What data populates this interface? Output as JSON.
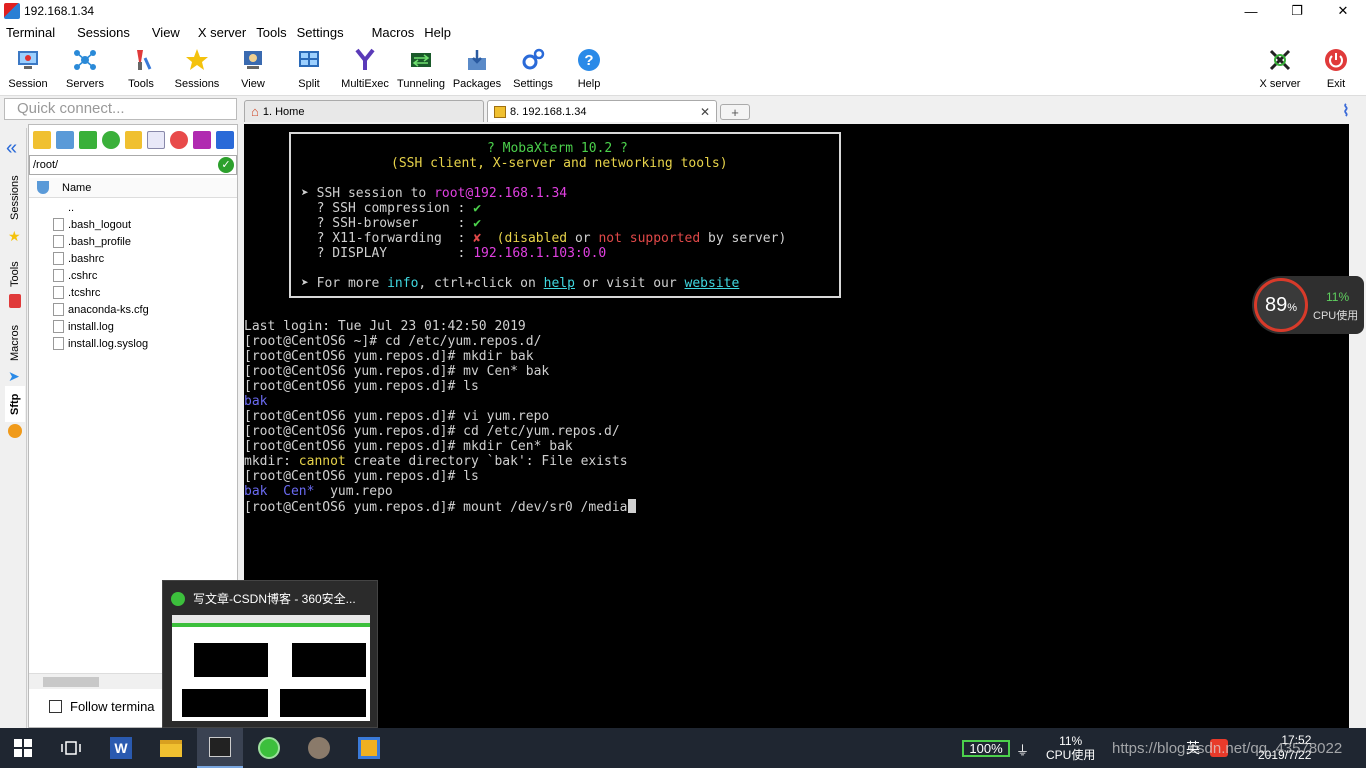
{
  "window": {
    "title": "192.168.1.34",
    "controls": [
      "—",
      "❐",
      "✕"
    ]
  },
  "menubar": [
    "Terminal",
    "Sessions",
    "View",
    "X server",
    "Tools",
    "Settings",
    "Macros",
    "Help"
  ],
  "toolbar": {
    "items": [
      {
        "label": "Session",
        "icon": "session-icon"
      },
      {
        "label": "Servers",
        "icon": "servers-icon"
      },
      {
        "label": "Tools",
        "icon": "tools-icon"
      },
      {
        "label": "Sessions",
        "icon": "star-icon"
      },
      {
        "label": "View",
        "icon": "view-icon"
      },
      {
        "label": "Split",
        "icon": "split-icon"
      },
      {
        "label": "MultiExec",
        "icon": "multiexec-icon"
      },
      {
        "label": "Tunneling",
        "icon": "tunneling-icon"
      },
      {
        "label": "Packages",
        "icon": "packages-icon"
      },
      {
        "label": "Settings",
        "icon": "settings-icon"
      },
      {
        "label": "Help",
        "icon": "help-icon"
      }
    ],
    "xserver_label": "X server",
    "exit_label": "Exit"
  },
  "quick_connect": {
    "placeholder": "Quick connect..."
  },
  "tabs": [
    {
      "label": "1. Home",
      "icon": "home-icon"
    },
    {
      "label": "8. 192.168.1.34",
      "icon": "key-icon",
      "close": "✕"
    }
  ],
  "new_tab": "+",
  "side_tabs": [
    "Sessions",
    "Tools",
    "Macros",
    "Sftp"
  ],
  "sftp": {
    "path": "/root/",
    "ok": "✓",
    "column_name": "Name",
    "files": [
      "..",
      ".bash_logout",
      ".bash_profile",
      ".bashrc",
      ".cshrc",
      ".tcshrc",
      "anaconda-ks.cfg",
      "install.log",
      "install.log.syslog"
    ],
    "follow_label": "Follow termina"
  },
  "terminal": {
    "banner": {
      "title": "? MobaXterm 10.2 ?",
      "subtitle": "(SSH client, X-server and networking tools)",
      "session_prefix": "➤ SSH session to ",
      "session_user": "root",
      "session_host": "@192.168.1.34",
      "compression_label": "  ? SSH compression : ",
      "browser_label": "  ? SSH-browser     : ",
      "x11_label": "  ? X11-forwarding  : ",
      "check": "✔",
      "cross": "✘",
      "x11_disabled": "(disabled",
      "x11_or": " or ",
      "x11_not_supported": "not supported",
      "x11_by_server": " by server)",
      "display_label": "  ? DISPLAY         : ",
      "display_value": "192.168.1.103:0.0",
      "info_prefix": "➤ For more ",
      "info_word": "info",
      "info_mid": ", ctrl+click on ",
      "help_link": "help",
      "info_mid2": " or visit our ",
      "website_link": "website"
    },
    "last_login": "Last login: Tue Jul 23 01:42:50 2019",
    "lines": [
      "[root@CentOS6 ~]# cd /etc/yum.repos.d/",
      "[root@CentOS6 yum.repos.d]# mkdir bak",
      "[root@CentOS6 yum.repos.d]# mv Cen* bak",
      "[root@CentOS6 yum.repos.d]# ls"
    ],
    "ls1": "bak",
    "lines2": [
      "[root@CentOS6 yum.repos.d]# vi yum.repo",
      "[root@CentOS6 yum.repos.d]# cd /etc/yum.repos.d/",
      "[root@CentOS6 yum.repos.d]# mkdir Cen* bak"
    ],
    "mkdir_prefix": "mkdir: ",
    "mkdir_cannot": "cannot",
    "mkdir_rest": " create directory `bak': File exists",
    "ls_cmd2": "[root@CentOS6 yum.repos.d]# ls",
    "ls2_bak": "bak",
    "ls2_cen": "  Cen*",
    "ls2_repo": "  yum.repo",
    "current_cmd": "[root@CentOS6 yum.repos.d]# mount /dev/sr0 /media"
  },
  "cpu_widget": {
    "mem": "89",
    "mem_unit": "%",
    "cpu": "11%",
    "label": "CPU使用"
  },
  "thumbnail": {
    "title": "写文章-CSDN博客 - 360安全..."
  },
  "taskbar": {
    "battery": "100%",
    "cpu_pct": "11%",
    "cpu_label": "CPU使用",
    "ime": "英",
    "time": "17:52",
    "date": "2019/7/22",
    "watermark": "https://blog.csdn.net/qq_43578022"
  },
  "colors": {
    "terminal_bg": "#000000",
    "taskbar_bg": "#1f2631",
    "accent_red": "#d83a2a"
  }
}
